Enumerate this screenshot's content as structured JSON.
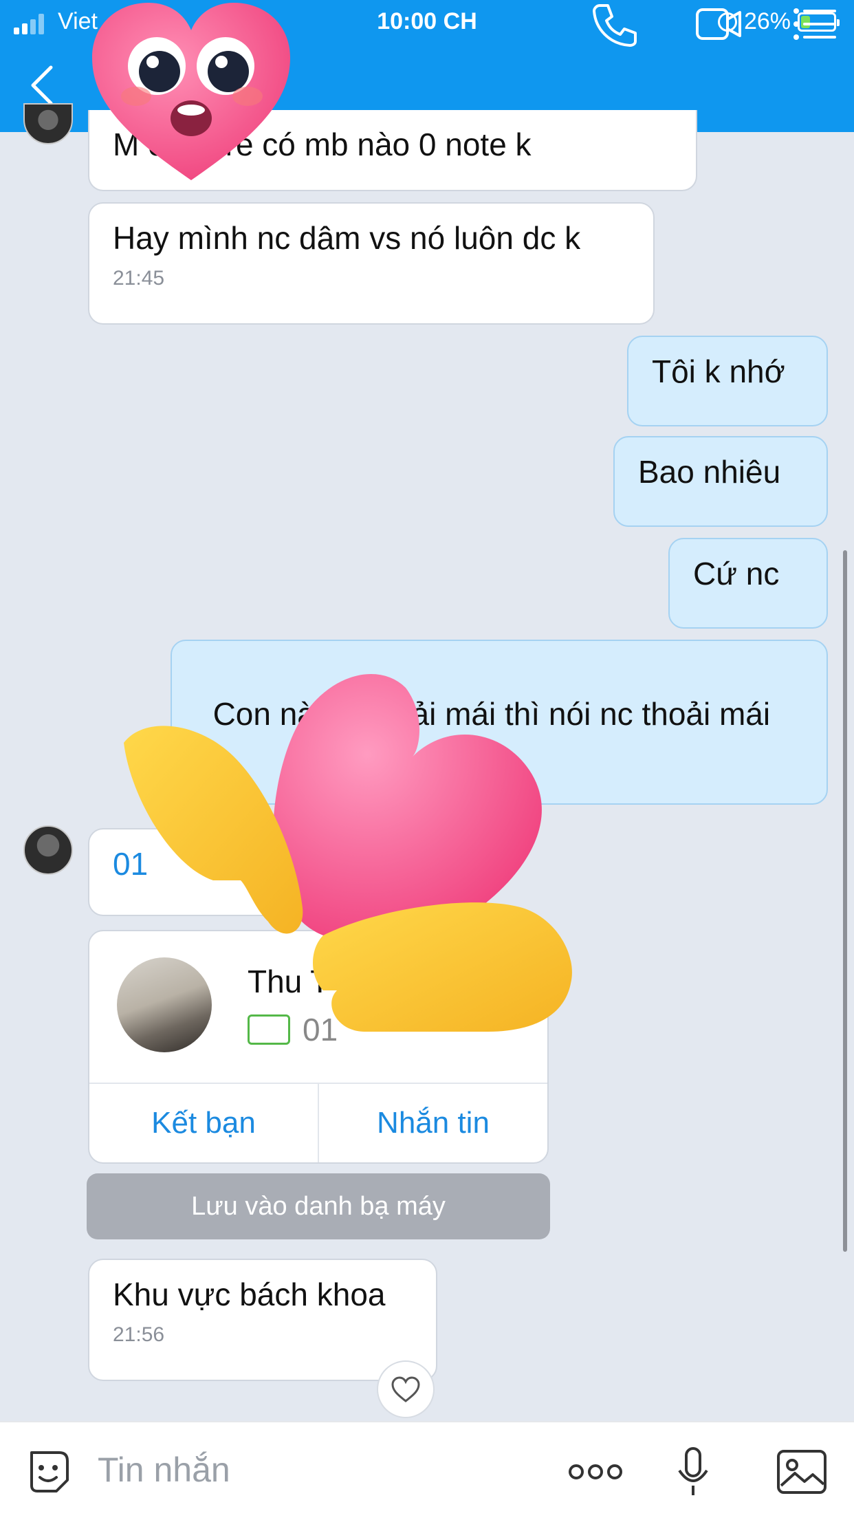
{
  "status_bar": {
    "carrier": "Viet",
    "time": "10:00 CH",
    "battery": "26%"
  },
  "header": {
    "back_icon": "chevron-left-icon",
    "call_icon": "phone-icon",
    "video_icon": "video-call-icon",
    "menu_icon": "list-menu-icon"
  },
  "messages": [
    {
      "id": "m1",
      "direction": "incoming",
      "text": "M    o share có mb nào 0 note k"
    },
    {
      "id": "m2",
      "direction": "incoming",
      "text": "Hay mình nc dâm vs nó luôn dc k",
      "time": "21:45"
    },
    {
      "id": "m3",
      "direction": "outgoing",
      "text": "Tôi k nhớ"
    },
    {
      "id": "m4",
      "direction": "outgoing",
      "text": "Bao nhiêu"
    },
    {
      "id": "m5",
      "direction": "outgoing",
      "text": "Cứ nc"
    },
    {
      "id": "m6",
      "direction": "outgoing",
      "text": "Con nà      thoải mái thì nói nc thoải mái"
    },
    {
      "id": "m7",
      "direction": "incoming",
      "text": "01"
    },
    {
      "id": "m8",
      "direction": "incoming",
      "text": "Khu vực bách khoa",
      "time": "21:56"
    }
  ],
  "contact_card": {
    "name": "Thu T",
    "phone": "01",
    "add_friend_label": "Kết bạn",
    "message_label": "Nhắn tin"
  },
  "save_contact_label": "Lưu vào danh bạ máy",
  "reaction_icon": "heart-outline-icon",
  "input": {
    "placeholder": "Tin nhắn",
    "sticker_icon": "sticker-icon",
    "more_icon": "more-dots-icon",
    "mic_icon": "microphone-icon",
    "image_icon": "image-icon"
  },
  "colors": {
    "header": "#0f97ef",
    "outgoing_bubble": "#d5edfd",
    "link": "#1b8ae0",
    "background": "#e3e8f0"
  }
}
